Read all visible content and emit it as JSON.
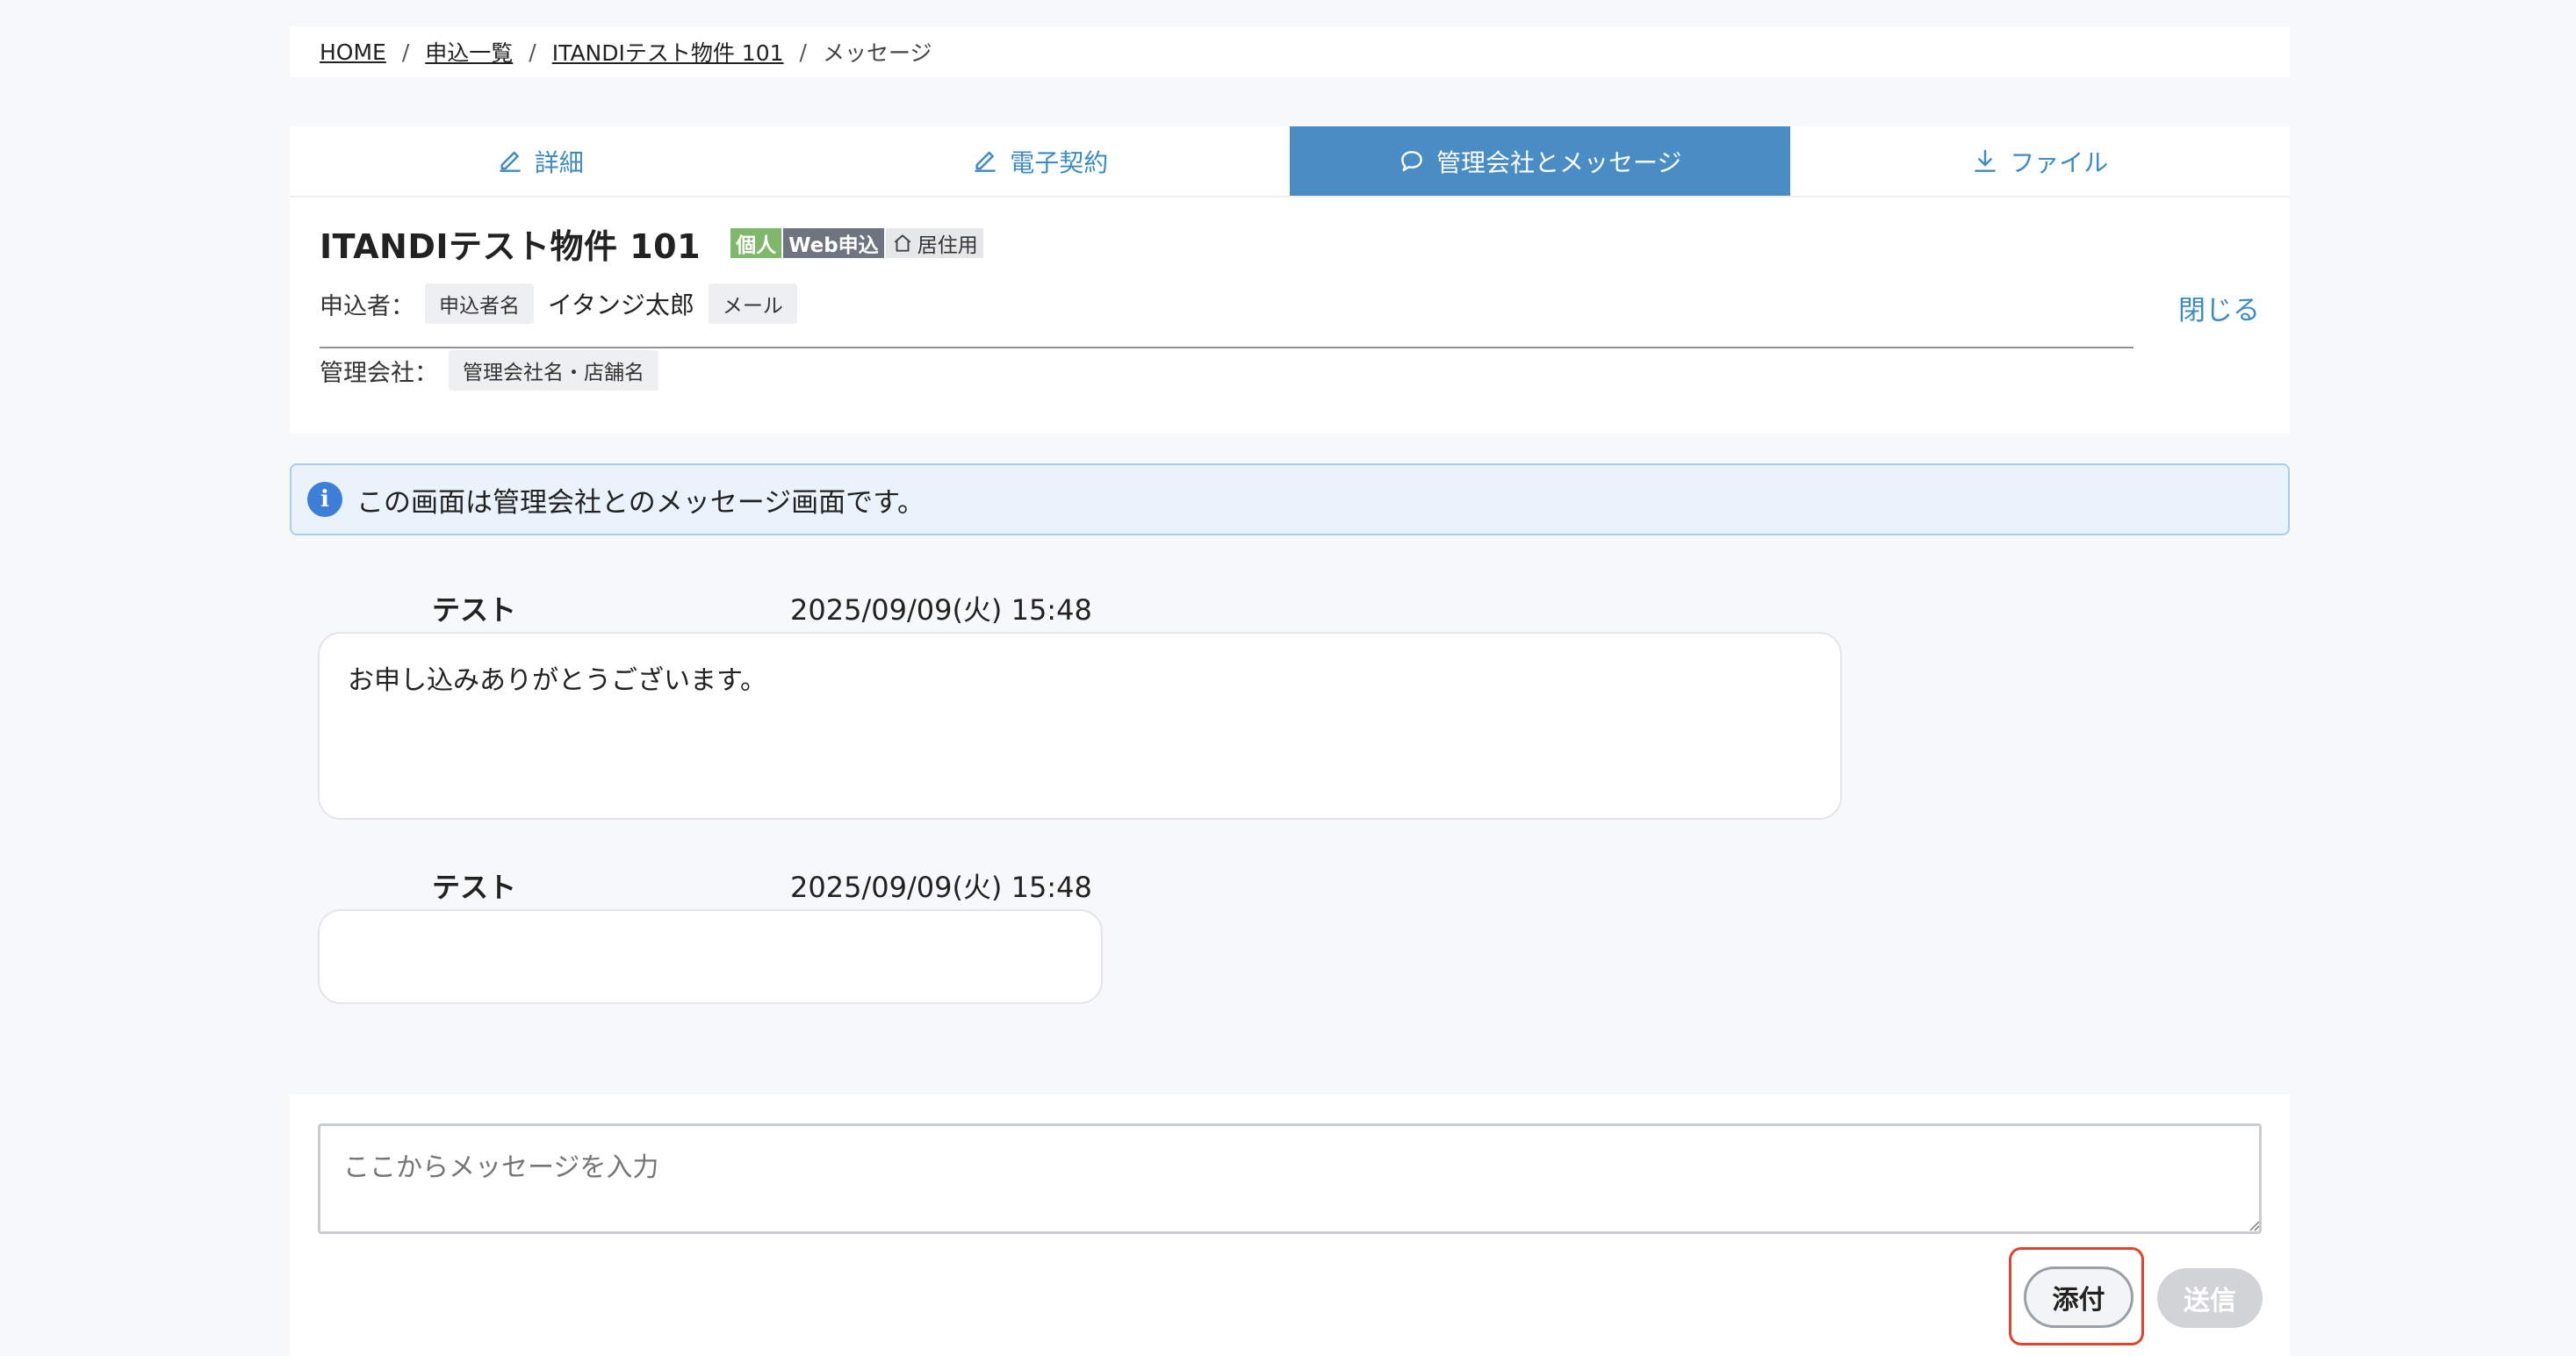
{
  "breadcrumb": {
    "home": "HOME",
    "list": "申込一覧",
    "property": "ITANDIテスト物件 101",
    "current": "メッセージ",
    "separator": "/"
  },
  "tabs": [
    {
      "label": "詳細",
      "icon": "edit-icon",
      "active": false
    },
    {
      "label": "電子契約",
      "icon": "edit-icon",
      "active": false
    },
    {
      "label": "管理会社とメッセージ",
      "icon": "chat-bubble-icon",
      "active": true
    },
    {
      "label": "ファイル",
      "icon": "download-icon",
      "active": false
    }
  ],
  "property": {
    "title": "ITANDIテスト物件 101",
    "tags": {
      "individual": "個人",
      "web": "Web申込",
      "residential": "居住用"
    }
  },
  "applicant": {
    "label": "申込者：",
    "name_chip": "申込者名",
    "name": "イタンジ太郎",
    "contact_chip": "メール"
  },
  "company": {
    "label": "管理会社：",
    "chip": "管理会社名・店舗名"
  },
  "close_label": "閉じる",
  "info": {
    "text": "この画面は管理会社とのメッセージ画面です。",
    "icon": "info-icon"
  },
  "messages": [
    {
      "sender": "テスト",
      "time": "2025/09/09(火) 15:48",
      "body": "お申し込みありがとうございます。"
    },
    {
      "sender": "テスト",
      "time": "2025/09/09(火) 15:48",
      "body": ""
    }
  ],
  "composer": {
    "placeholder": "ここからメッセージを入力",
    "attach_label": "添付",
    "send_label": "送信"
  },
  "colors": {
    "accent": "#4a8dc5",
    "link": "#3d8ac4",
    "highlight": "#e0442f",
    "tag_green": "#7fb86a",
    "tag_gray": "#6e7580"
  }
}
